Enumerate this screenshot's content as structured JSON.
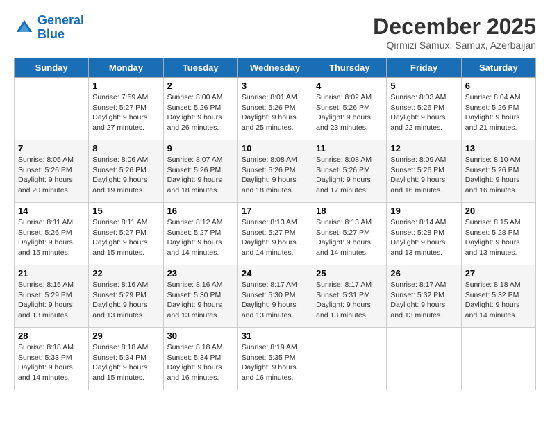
{
  "header": {
    "logo_line1": "General",
    "logo_line2": "Blue",
    "month": "December 2025",
    "location": "Qirmizi Samux, Samux, Azerbaijan"
  },
  "days_of_week": [
    "Sunday",
    "Monday",
    "Tuesday",
    "Wednesday",
    "Thursday",
    "Friday",
    "Saturday"
  ],
  "weeks": [
    [
      {
        "date": "",
        "sunrise": "",
        "sunset": "",
        "daylight": ""
      },
      {
        "date": "1",
        "sunrise": "Sunrise: 7:59 AM",
        "sunset": "Sunset: 5:27 PM",
        "daylight": "Daylight: 9 hours and 27 minutes."
      },
      {
        "date": "2",
        "sunrise": "Sunrise: 8:00 AM",
        "sunset": "Sunset: 5:26 PM",
        "daylight": "Daylight: 9 hours and 26 minutes."
      },
      {
        "date": "3",
        "sunrise": "Sunrise: 8:01 AM",
        "sunset": "Sunset: 5:26 PM",
        "daylight": "Daylight: 9 hours and 25 minutes."
      },
      {
        "date": "4",
        "sunrise": "Sunrise: 8:02 AM",
        "sunset": "Sunset: 5:26 PM",
        "daylight": "Daylight: 9 hours and 23 minutes."
      },
      {
        "date": "5",
        "sunrise": "Sunrise: 8:03 AM",
        "sunset": "Sunset: 5:26 PM",
        "daylight": "Daylight: 9 hours and 22 minutes."
      },
      {
        "date": "6",
        "sunrise": "Sunrise: 8:04 AM",
        "sunset": "Sunset: 5:26 PM",
        "daylight": "Daylight: 9 hours and 21 minutes."
      }
    ],
    [
      {
        "date": "7",
        "sunrise": "Sunrise: 8:05 AM",
        "sunset": "Sunset: 5:26 PM",
        "daylight": "Daylight: 9 hours and 20 minutes."
      },
      {
        "date": "8",
        "sunrise": "Sunrise: 8:06 AM",
        "sunset": "Sunset: 5:26 PM",
        "daylight": "Daylight: 9 hours and 19 minutes."
      },
      {
        "date": "9",
        "sunrise": "Sunrise: 8:07 AM",
        "sunset": "Sunset: 5:26 PM",
        "daylight": "Daylight: 9 hours and 18 minutes."
      },
      {
        "date": "10",
        "sunrise": "Sunrise: 8:08 AM",
        "sunset": "Sunset: 5:26 PM",
        "daylight": "Daylight: 9 hours and 18 minutes."
      },
      {
        "date": "11",
        "sunrise": "Sunrise: 8:08 AM",
        "sunset": "Sunset: 5:26 PM",
        "daylight": "Daylight: 9 hours and 17 minutes."
      },
      {
        "date": "12",
        "sunrise": "Sunrise: 8:09 AM",
        "sunset": "Sunset: 5:26 PM",
        "daylight": "Daylight: 9 hours and 16 minutes."
      },
      {
        "date": "13",
        "sunrise": "Sunrise: 8:10 AM",
        "sunset": "Sunset: 5:26 PM",
        "daylight": "Daylight: 9 hours and 16 minutes."
      }
    ],
    [
      {
        "date": "14",
        "sunrise": "Sunrise: 8:11 AM",
        "sunset": "Sunset: 5:26 PM",
        "daylight": "Daylight: 9 hours and 15 minutes."
      },
      {
        "date": "15",
        "sunrise": "Sunrise: 8:11 AM",
        "sunset": "Sunset: 5:27 PM",
        "daylight": "Daylight: 9 hours and 15 minutes."
      },
      {
        "date": "16",
        "sunrise": "Sunrise: 8:12 AM",
        "sunset": "Sunset: 5:27 PM",
        "daylight": "Daylight: 9 hours and 14 minutes."
      },
      {
        "date": "17",
        "sunrise": "Sunrise: 8:13 AM",
        "sunset": "Sunset: 5:27 PM",
        "daylight": "Daylight: 9 hours and 14 minutes."
      },
      {
        "date": "18",
        "sunrise": "Sunrise: 8:13 AM",
        "sunset": "Sunset: 5:27 PM",
        "daylight": "Daylight: 9 hours and 14 minutes."
      },
      {
        "date": "19",
        "sunrise": "Sunrise: 8:14 AM",
        "sunset": "Sunset: 5:28 PM",
        "daylight": "Daylight: 9 hours and 13 minutes."
      },
      {
        "date": "20",
        "sunrise": "Sunrise: 8:15 AM",
        "sunset": "Sunset: 5:28 PM",
        "daylight": "Daylight: 9 hours and 13 minutes."
      }
    ],
    [
      {
        "date": "21",
        "sunrise": "Sunrise: 8:15 AM",
        "sunset": "Sunset: 5:29 PM",
        "daylight": "Daylight: 9 hours and 13 minutes."
      },
      {
        "date": "22",
        "sunrise": "Sunrise: 8:16 AM",
        "sunset": "Sunset: 5:29 PM",
        "daylight": "Daylight: 9 hours and 13 minutes."
      },
      {
        "date": "23",
        "sunrise": "Sunrise: 8:16 AM",
        "sunset": "Sunset: 5:30 PM",
        "daylight": "Daylight: 9 hours and 13 minutes."
      },
      {
        "date": "24",
        "sunrise": "Sunrise: 8:17 AM",
        "sunset": "Sunset: 5:30 PM",
        "daylight": "Daylight: 9 hours and 13 minutes."
      },
      {
        "date": "25",
        "sunrise": "Sunrise: 8:17 AM",
        "sunset": "Sunset: 5:31 PM",
        "daylight": "Daylight: 9 hours and 13 minutes."
      },
      {
        "date": "26",
        "sunrise": "Sunrise: 8:17 AM",
        "sunset": "Sunset: 5:32 PM",
        "daylight": "Daylight: 9 hours and 13 minutes."
      },
      {
        "date": "27",
        "sunrise": "Sunrise: 8:18 AM",
        "sunset": "Sunset: 5:32 PM",
        "daylight": "Daylight: 9 hours and 14 minutes."
      }
    ],
    [
      {
        "date": "28",
        "sunrise": "Sunrise: 8:18 AM",
        "sunset": "Sunset: 5:33 PM",
        "daylight": "Daylight: 9 hours and 14 minutes."
      },
      {
        "date": "29",
        "sunrise": "Sunrise: 8:18 AM",
        "sunset": "Sunset: 5:34 PM",
        "daylight": "Daylight: 9 hours and 15 minutes."
      },
      {
        "date": "30",
        "sunrise": "Sunrise: 8:18 AM",
        "sunset": "Sunset: 5:34 PM",
        "daylight": "Daylight: 9 hours and 16 minutes."
      },
      {
        "date": "31",
        "sunrise": "Sunrise: 8:19 AM",
        "sunset": "Sunset: 5:35 PM",
        "daylight": "Daylight: 9 hours and 16 minutes."
      },
      {
        "date": "",
        "sunrise": "",
        "sunset": "",
        "daylight": ""
      },
      {
        "date": "",
        "sunrise": "",
        "sunset": "",
        "daylight": ""
      },
      {
        "date": "",
        "sunrise": "",
        "sunset": "",
        "daylight": ""
      }
    ]
  ]
}
